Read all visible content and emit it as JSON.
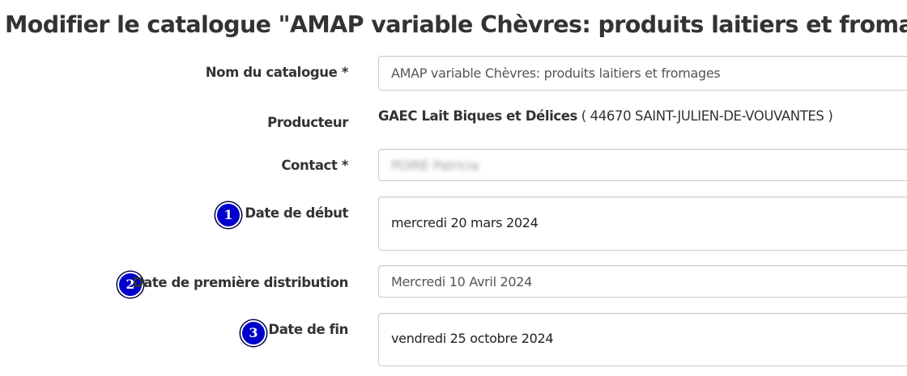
{
  "page": {
    "title": "Modifier le catalogue \"AMAP variable Chèvres: produits laitiers et fromages\""
  },
  "form": {
    "catalog_name": {
      "label": "Nom du catalogue *",
      "value": "AMAP variable Chèvres: produits laitiers et fromages"
    },
    "producer": {
      "label": "Producteur",
      "name": "GAEC Lait Biques et Délices",
      "location": "( 44670 SAINT-JULIEN-DE-VOUVANTES )"
    },
    "contact": {
      "label": "Contact *",
      "value": "POIRE Patricia"
    },
    "start_date": {
      "badge": "1",
      "label": "Date de début",
      "value": "mercredi 20 mars 2024"
    },
    "first_distribution": {
      "badge": "2",
      "label": "Date de première distribution",
      "value": "Mercredi 10 Avril 2024"
    },
    "end_date": {
      "badge": "3",
      "label": "Date de fin",
      "value": "vendredi 25 octobre 2024"
    }
  },
  "colors": {
    "badge": "#0000cc",
    "text": "#333333",
    "border": "#cccccc"
  }
}
